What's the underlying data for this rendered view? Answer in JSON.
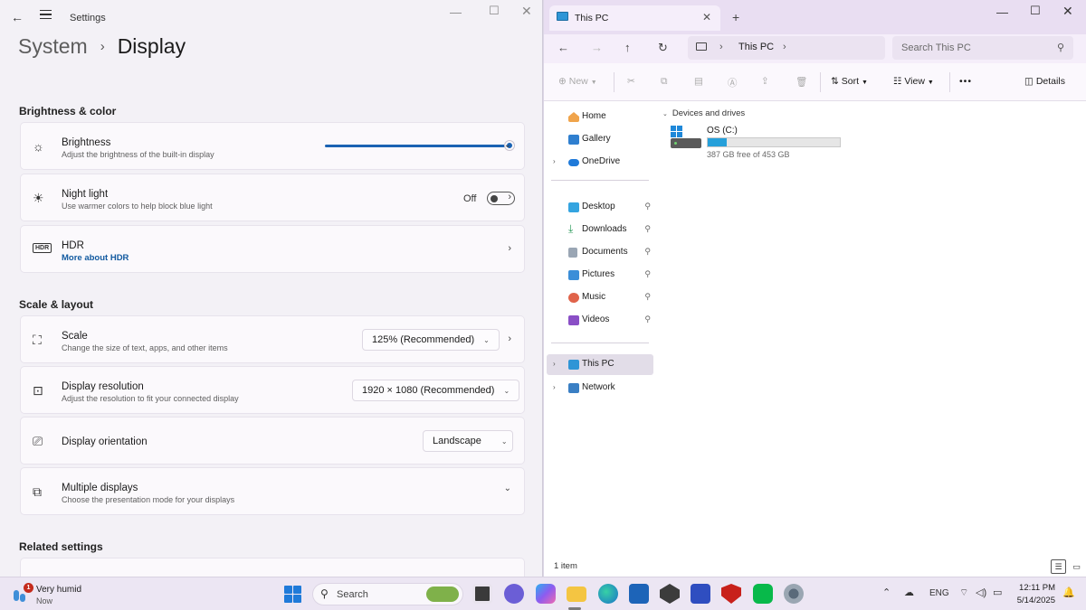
{
  "settings": {
    "title": "Settings",
    "breadcrumb": {
      "parent": "System",
      "separator": "›",
      "current": "Display"
    },
    "sections": {
      "brightness_color": "Brightness & color",
      "scale_layout": "Scale & layout",
      "related": "Related settings"
    },
    "brightness": {
      "title": "Brightness",
      "desc": "Adjust the brightness of the built-in display",
      "value_fraction": 1.0
    },
    "night_light": {
      "title": "Night light",
      "desc": "Use warmer colors to help block blue light",
      "state": "Off"
    },
    "hdr": {
      "title": "HDR",
      "link": "More about HDR"
    },
    "scale": {
      "title": "Scale",
      "desc": "Change the size of text, apps, and other items",
      "value": "125% (Recommended)"
    },
    "resolution": {
      "title": "Display resolution",
      "desc": "Adjust the resolution to fit your connected display",
      "value": "1920 × 1080 (Recommended)"
    },
    "orientation": {
      "title": "Display orientation",
      "value": "Landscape"
    },
    "multiple": {
      "title": "Multiple displays",
      "desc": "Choose the presentation mode for your displays"
    }
  },
  "explorer": {
    "tab_title": "This PC",
    "address": "This PC",
    "search_placeholder": "Search This PC",
    "commands": {
      "new": "New",
      "sort": "Sort",
      "view": "View",
      "more": "•••",
      "details": "Details"
    },
    "nav": {
      "home": "Home",
      "gallery": "Gallery",
      "onedrive": "OneDrive",
      "desktop": "Desktop",
      "downloads": "Downloads",
      "documents": "Documents",
      "pictures": "Pictures",
      "music": "Music",
      "videos": "Videos",
      "this_pc": "This PC",
      "network": "Network"
    },
    "group": "Devices and drives",
    "drive": {
      "name": "OS (C:)",
      "free": "387 GB free of 453 GB",
      "used_fraction": 0.146
    },
    "status": "1 item"
  },
  "taskbar": {
    "weather": {
      "title": "Very humid",
      "sub": "Now",
      "badge": "1"
    },
    "search": "Search",
    "lang": "ENG",
    "time": "12:11 PM",
    "date": "5/14/2025"
  },
  "colors": {
    "accent": "#1a63b3",
    "drive_bar": "#26a0da",
    "tab_bg": "#e9def2"
  }
}
